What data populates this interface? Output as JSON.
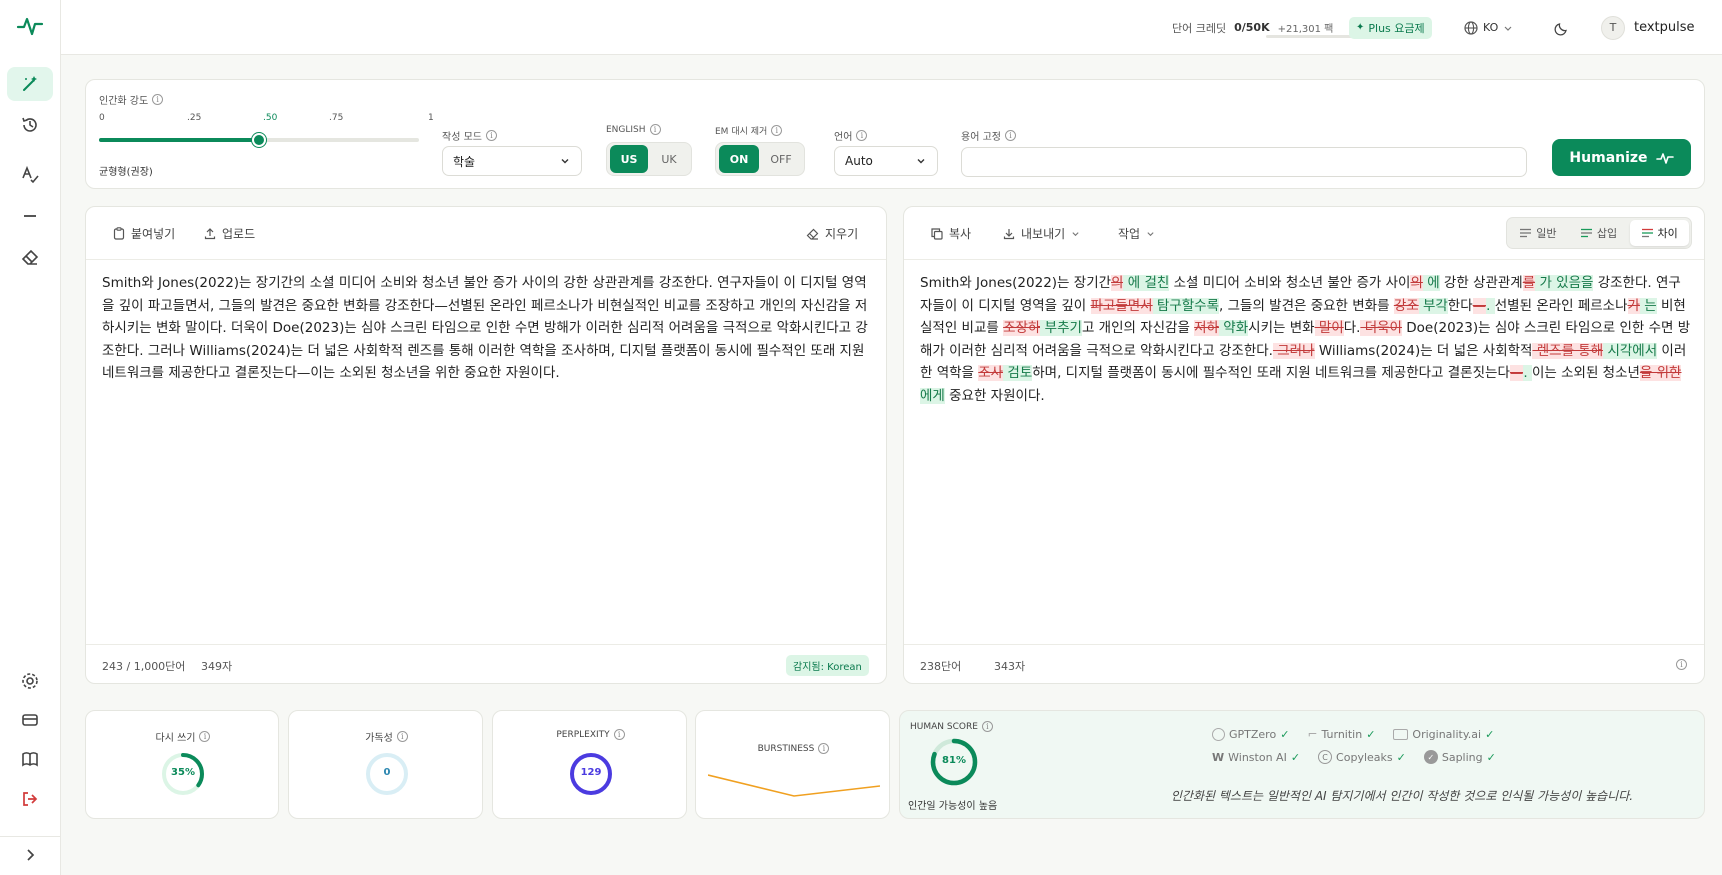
{
  "brand": {
    "accent": "#0b8a5a",
    "accent_light": "#e2f6ec"
  },
  "topbar": {
    "credits_label": "단어 크레딧",
    "credits_value": "0/50K",
    "credits_bonus": "+21,301 팩",
    "plan_badge": "Plus 요금제",
    "language": "KO",
    "avatar_letter": "T",
    "username": "textpulse"
  },
  "controls": {
    "strength_label": "인간화 강도",
    "ticks": [
      "0",
      ".25",
      ".50",
      ".75",
      "1"
    ],
    "strength_value": 0.5,
    "strength_caption": "균형형(권장)",
    "mode_label": "작성 모드",
    "mode_value": "학술",
    "english_label": "ENGLISH",
    "english_options": [
      "US",
      "UK"
    ],
    "em_label": "EM 대시 제거",
    "em_options": [
      "ON",
      "OFF"
    ],
    "lang_label": "언어",
    "lang_value": "Auto",
    "terms_label": "용어 고정",
    "terms_value": "",
    "humanize_button": "Humanize"
  },
  "left_editor": {
    "paste": "붙여넣기",
    "upload": "업로드",
    "clear": "지우기",
    "text": "Smith와 Jones(2022)는 장기간의 소셜 미디어 소비와 청소년 불안 증가 사이의 강한 상관관계를 강조한다. 연구자들이 이 디지털 영역을 깊이 파고들면서, 그들의 발견은 중요한 변화를 강조한다—선별된 온라인 페르소나가 비현실적인 비교를 조장하고 개인의 자신감을 저하시키는 변화 말이다. 더욱이 Doe(2023)는 심야 스크린 타임으로 인한 수면 방해가 이러한 심리적 어려움을 극적으로 악화시킨다고 강조한다. 그러나 Williams(2024)는 더 넓은 사회학적 렌즈를 통해 이러한 역학을 조사하며, 디지털 플랫폼이 동시에 필수적인 또래 지원 네트워크를 제공한다고 결론짓는다—이는 소외된 청소년을 위한 중요한 자원이다.",
    "word_count": "243 / 1,000단어",
    "char_count": "349자",
    "detected": "감지됨: Korean"
  },
  "right_editor": {
    "copy": "복사",
    "export": "내보내기",
    "actions": "작업",
    "view_normal": "일반",
    "view_insert": "삽입",
    "view_diff": "차이",
    "segments": [
      {
        "t": "Smith와 Jones(2022)는 장기간",
        "k": "n"
      },
      {
        "t": "의",
        "k": "d"
      },
      {
        "t": " 에 걸친",
        "k": "i"
      },
      {
        "t": " 소셜 미디어 소비와 청소년 불안 증가 사이",
        "k": "n"
      },
      {
        "t": "의",
        "k": "d"
      },
      {
        "t": " 에",
        "k": "i"
      },
      {
        "t": " 강한 상관관계",
        "k": "n"
      },
      {
        "t": "를",
        "k": "d"
      },
      {
        "t": " 가 있음을",
        "k": "i"
      },
      {
        "t": " 강조한다. 연구자들이 이 디지털 영역을 깊이 ",
        "k": "n"
      },
      {
        "t": "파고들면서",
        "k": "d"
      },
      {
        "t": " 탐구할수록",
        "k": "i"
      },
      {
        "t": ", 그들의 발견은 중요한 변화를 ",
        "k": "n"
      },
      {
        "t": "강조",
        "k": "d"
      },
      {
        "t": " 부각",
        "k": "i"
      },
      {
        "t": "한다",
        "k": "n"
      },
      {
        "t": "—",
        "k": "d"
      },
      {
        "t": ". ",
        "k": "i"
      },
      {
        "t": "선별된 온라인 페르소나",
        "k": "n"
      },
      {
        "t": "가",
        "k": "d"
      },
      {
        "t": " 는",
        "k": "i"
      },
      {
        "t": " 비현실적인 비교를 ",
        "k": "n"
      },
      {
        "t": "조장하",
        "k": "d"
      },
      {
        "t": " 부추기",
        "k": "i"
      },
      {
        "t": "고 개인의 자신감을 ",
        "k": "n"
      },
      {
        "t": "저하",
        "k": "d"
      },
      {
        "t": " 약화",
        "k": "i"
      },
      {
        "t": "시키는 변화",
        "k": "n"
      },
      {
        "t": " 말이",
        "k": "d"
      },
      {
        "t": "다.",
        "k": "n"
      },
      {
        "t": " 더욱이",
        "k": "d"
      },
      {
        "t": " Doe(2023)는 심야 스크린 타임으로 인한 수면 방해가 이러한 심리적 어려움을 극적으로 악화시킨다고 강조한다.",
        "k": "n"
      },
      {
        "t": " 그러나",
        "k": "d"
      },
      {
        "t": " Williams(2024)는 더 넓은 사회학적",
        "k": "n"
      },
      {
        "t": " 렌즈를 통해",
        "k": "d"
      },
      {
        "t": " 시각에서",
        "k": "i"
      },
      {
        "t": " 이러한 역학을 ",
        "k": "n"
      },
      {
        "t": "조사",
        "k": "d"
      },
      {
        "t": " 검토",
        "k": "i"
      },
      {
        "t": "하며, 디지털 플랫폼이 동시에 필수적인 또래 지원 네트워크를 제공한다고 결론짓는다",
        "k": "n"
      },
      {
        "t": "—",
        "k": "d"
      },
      {
        "t": ". ",
        "k": "i"
      },
      {
        "t": "이는 소외된 청소년",
        "k": "n"
      },
      {
        "t": "을 위한",
        "k": "d"
      },
      {
        "t": " 에게",
        "k": "i"
      },
      {
        "t": " 중요한 자원이다.",
        "k": "n"
      }
    ],
    "word_count": "238단어",
    "char_count": "343자"
  },
  "metrics": {
    "rewrite_label": "다시 쓰기",
    "rewrite_value": "35%",
    "rewrite_fraction": 0.35,
    "readability_label": "가독성",
    "readability_value": "0",
    "perplexity_label": "PERPLEXITY",
    "perplexity_value": "129",
    "burstiness_label": "BURSTINESS",
    "human_score_label": "HUMAN SCORE",
    "human_score_value": "81%",
    "human_score_fraction": 0.81,
    "human_score_caption": "인간일 가능성이 높음",
    "detectors": [
      "GPTZero",
      "Turnitin",
      "Originality.ai",
      "Winston AI",
      "Copyleaks",
      "Sapling"
    ],
    "footnote": "인간화된 텍스트는 일반적인 AI 탐지기에서 인간이 작성한 것으로 인식될 가능성이 높습니다."
  }
}
